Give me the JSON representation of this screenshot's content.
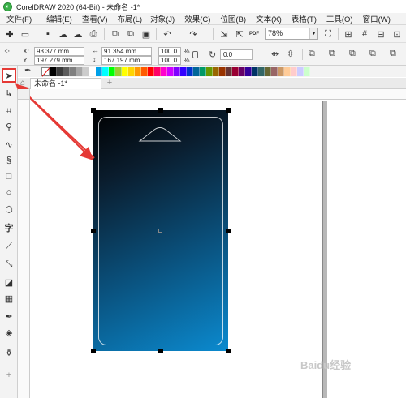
{
  "window": {
    "title": "CorelDRAW 2020 (64-Bit) - 未命名 -1*",
    "logo": "coreldraw-logo"
  },
  "menu": [
    "文件(F)",
    "编辑(E)",
    "查看(V)",
    "布局(L)",
    "对象(J)",
    "效果(C)",
    "位图(B)",
    "文本(X)",
    "表格(T)",
    "工具(O)",
    "窗口(W)"
  ],
  "toolbar": {
    "zoom": "78%",
    "pdf_label": "PDF"
  },
  "properties": {
    "x_label": "X:",
    "x_value": "93.377 mm",
    "y_label": "Y:",
    "y_value": "197.279 mm",
    "width_value": "91.354 mm",
    "height_value": "167.197 mm",
    "scale_w": "100.0",
    "scale_h": "100.0",
    "percent": "%",
    "rotation": "0.0"
  },
  "document_tab": {
    "label": "未命名 -1*"
  },
  "palette": {
    "colors": [
      "#000000",
      "#3a3a3a",
      "#5c5c5c",
      "#7f7f7f",
      "#a6a6a6",
      "#cccccc",
      "#ffffff",
      "#00a0e9",
      "#00ffff",
      "#00ff00",
      "#9acd32",
      "#ffff00",
      "#ffd400",
      "#ff9900",
      "#ff5a00",
      "#ff0000",
      "#ff0066",
      "#ff00cc",
      "#cc00ff",
      "#7f00ff",
      "#3300ff",
      "#0033cc",
      "#006699",
      "#009966",
      "#669900",
      "#996600",
      "#993300",
      "#663333",
      "#990033",
      "#660066",
      "#330099",
      "#003366",
      "#336666",
      "#666633",
      "#996666",
      "#cc9966",
      "#ffcc99",
      "#ffcccc",
      "#ccccff",
      "#ccffcc"
    ]
  },
  "object": {
    "gradient_start": "#000000",
    "gradient_end": "#0b8acf",
    "handle_color": "#000000"
  },
  "annotation": {
    "arrow_color": "#e53935"
  },
  "watermark": "Baidu经验"
}
